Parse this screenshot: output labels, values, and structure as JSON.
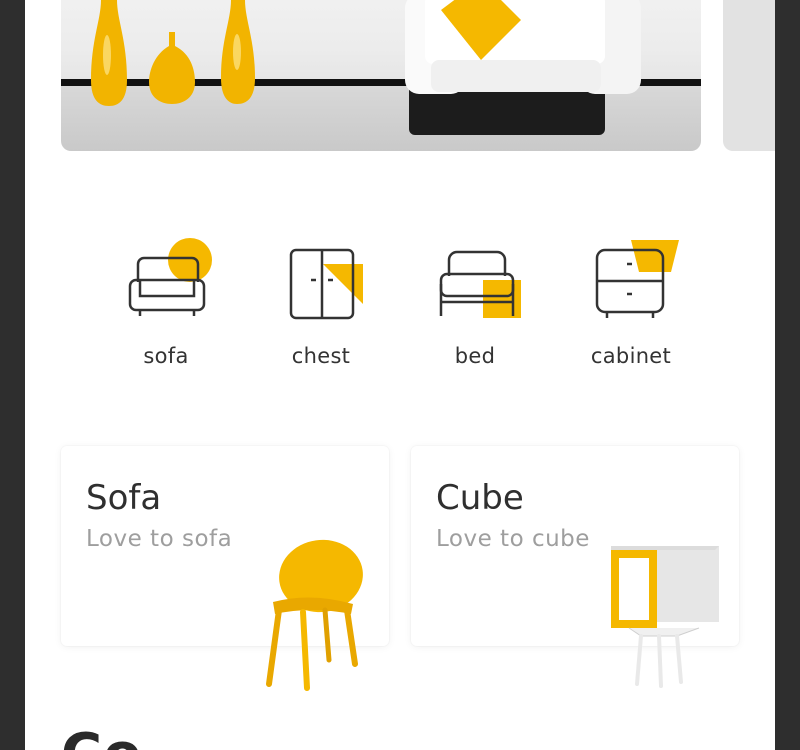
{
  "colors": {
    "accent": "#F5B800",
    "text": "#333333",
    "muted": "#9E9E9E"
  },
  "hero": {
    "image": "living-room-banner"
  },
  "categories": [
    {
      "label": "sofa",
      "icon": "sofa-icon"
    },
    {
      "label": "chest",
      "icon": "chest-icon"
    },
    {
      "label": "bed",
      "icon": "bed-icon"
    },
    {
      "label": "cabinet",
      "icon": "cabinet-icon"
    }
  ],
  "cards": [
    {
      "title": "Sofa",
      "subtitle": "Love to sofa",
      "image": "yellow-chair"
    },
    {
      "title": "Cube",
      "subtitle": "Love to cube",
      "image": "yellow-cube-table"
    }
  ],
  "section": {
    "title": "Co"
  }
}
